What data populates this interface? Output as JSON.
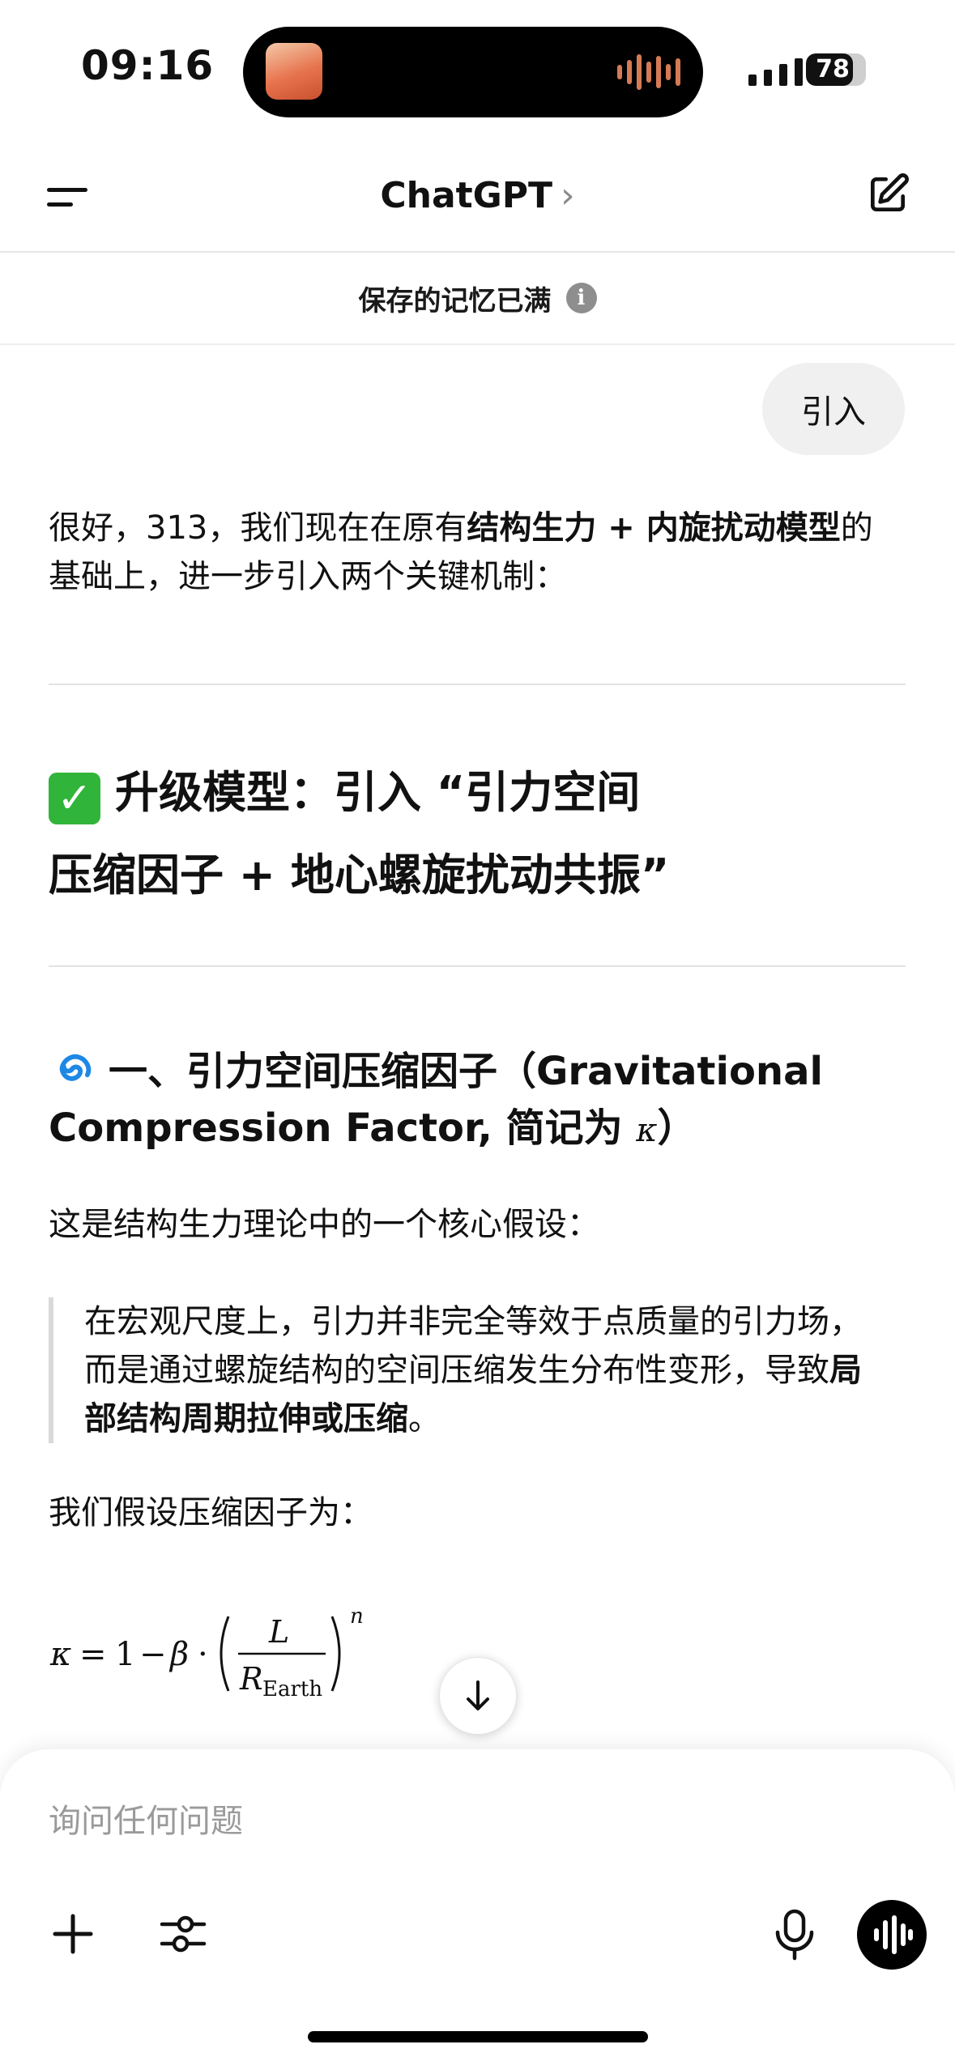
{
  "status_bar": {
    "time": "09:16",
    "battery_percent": "78",
    "battery_level": 0.78
  },
  "nav": {
    "title": "ChatGPT",
    "chevron": "›"
  },
  "banner": {
    "text": "保存的记忆已满",
    "info_glyph": "i"
  },
  "chat": {
    "user_message": "引入",
    "intro_1": "很好，313，我们现在在原有",
    "intro_bold": "结构生力 + 内旋扰动模型",
    "intro_2": "的",
    "intro_line2": "基础上，进一步引入两个关键机制：",
    "h2_line1": "升级模型：引入 “引力空间",
    "h2_line2": "压缩因子 + 地心螺旋扰动共振”",
    "h3_line1": "一、引力空间压缩因子（Gravitational",
    "h3_line2": "Compression Factor, 简记为 ",
    "h3_kappa": "κ",
    "h3_close": "）",
    "para_core": "这是结构生力理论中的一个核心假设：",
    "quote_line1": "在宏观尺度上，引力并非完全等效于点质量的引力场，",
    "quote_line2a": "而是通过螺旋结构的空间压缩发生分布性变形，导致",
    "quote_line2b": "局",
    "quote_line3_bold": "部结构周期拉伸或压缩",
    "quote_line3_end": "。",
    "para_assume": "我们假设压缩因子为：",
    "formula": {
      "lhs": "κ",
      "eq": "=",
      "one": "1",
      "minus": "−",
      "beta": "β",
      "dot": "·",
      "num": "L",
      "den_main": "R",
      "den_sub": "Earth",
      "exp": "n"
    }
  },
  "composer": {
    "placeholder": "询问任何问题"
  },
  "icons": {
    "status_check": "white-check-on-green-square",
    "section_icon": "cyclone-icon"
  },
  "colors": {
    "accent_check": "#31b43a",
    "cyclone": "#1e88e5",
    "banner_info": "#8e8e8e"
  }
}
